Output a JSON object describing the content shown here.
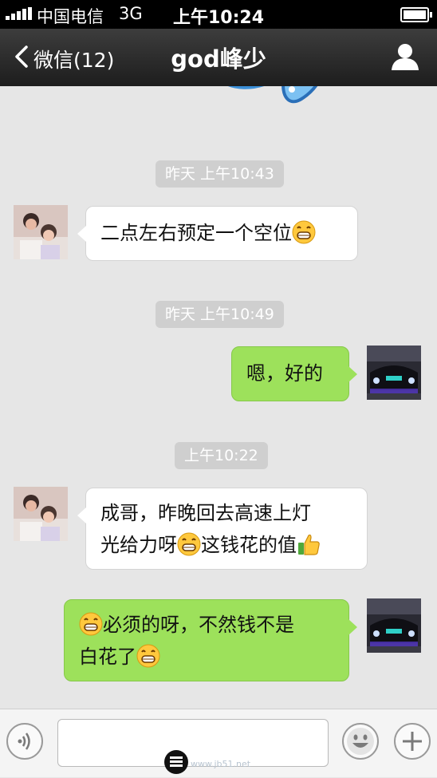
{
  "status_bar": {
    "carrier": "中国电信",
    "network": "3G",
    "time": "上午10:24"
  },
  "nav": {
    "back_label": "微信(12)",
    "title": "god峰少"
  },
  "messages": [
    {
      "kind": "timestamp",
      "text": "昨天 上午10:43"
    },
    {
      "kind": "incoming",
      "text": "二点左右预定一个空位",
      "trailing_emoji": "grin-emoji"
    },
    {
      "kind": "timestamp",
      "text": "昨天 上午10:49"
    },
    {
      "kind": "outgoing",
      "text": "嗯，好的"
    },
    {
      "kind": "timestamp",
      "text": "上午10:22"
    },
    {
      "kind": "incoming",
      "line1": "成哥，昨晚回去高速上灯",
      "line2a": "光给力呀",
      "line2b": "这钱花的值",
      "emojis": [
        "grin-emoji",
        "thumbs-up-emoji"
      ]
    },
    {
      "kind": "outgoing",
      "line1": "必须的呀，不然钱不是",
      "line2": "白花了",
      "emojis": [
        "grin-emoji",
        "grin-emoji"
      ]
    }
  ],
  "colors": {
    "outgoing_bubble": "#9de15b",
    "incoming_bubble": "#ffffff",
    "chat_background": "#e6e6e6",
    "timestamp_badge": "#cfcfcf"
  },
  "input_bar": {
    "left_icon": "voice-icon",
    "right_icons": [
      "emoji-smiley-icon",
      "plus-icon"
    ],
    "watermark_text": "www.jb51.net"
  }
}
